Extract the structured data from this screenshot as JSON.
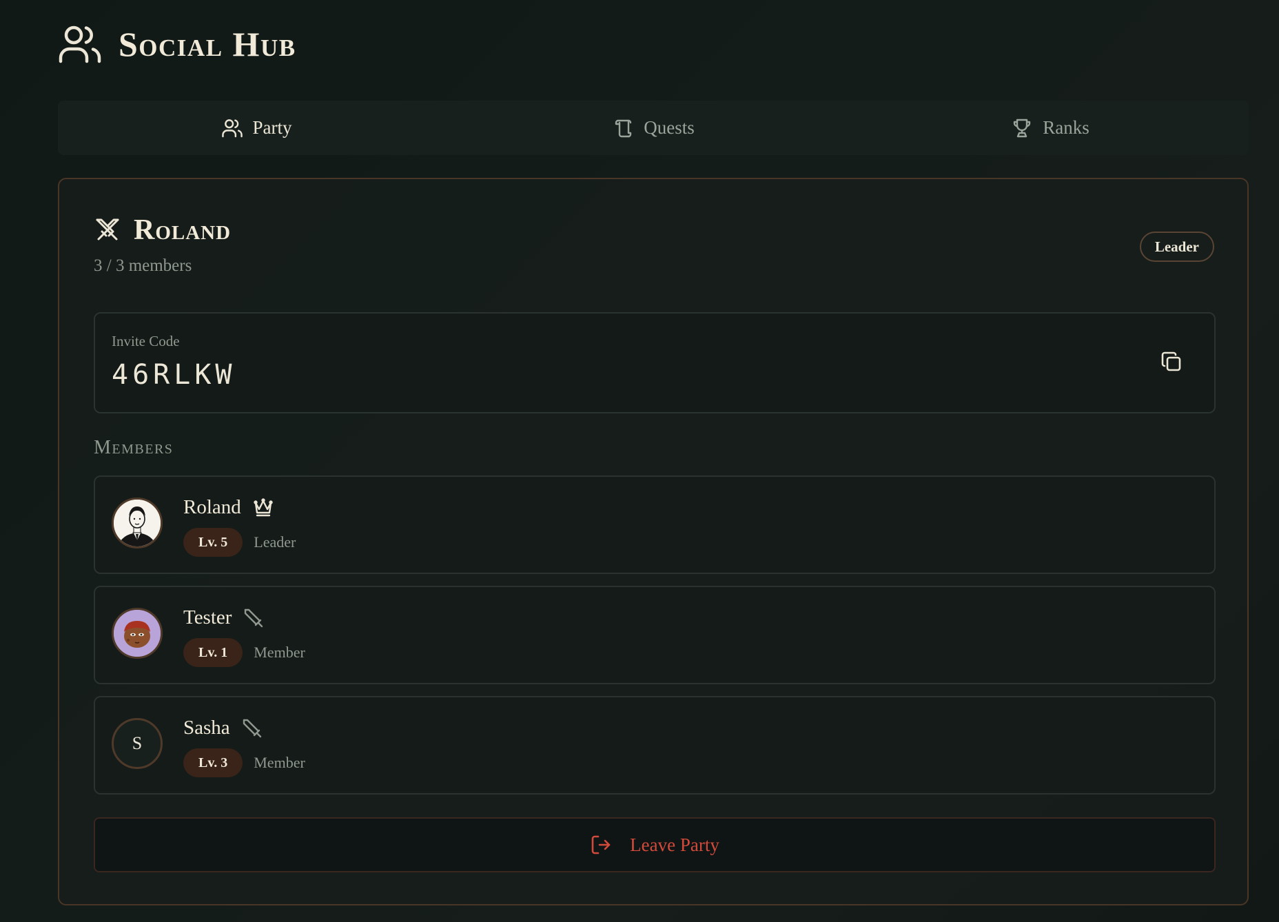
{
  "app": {
    "title": "Social Hub",
    "icon": "users-icon"
  },
  "tabs": [
    {
      "label": "Party",
      "icon": "users-icon",
      "active": true
    },
    {
      "label": "Quests",
      "icon": "scroll-icon",
      "active": false
    },
    {
      "label": "Ranks",
      "icon": "trophy-icon",
      "active": false
    }
  ],
  "party": {
    "name": "Roland",
    "icon": "crossed-swords-icon",
    "member_count": "3 / 3 members",
    "badge": "Leader",
    "invite": {
      "label": "Invite Code",
      "code": "46RLKW",
      "copy_icon": "copy-icon"
    },
    "members_title": "Members",
    "members": [
      {
        "name": "Roland",
        "level": "Lv. 5",
        "role": "Leader",
        "role_icon": "crown-icon",
        "avatar": "portrait-illustration"
      },
      {
        "name": "Tester",
        "level": "Lv. 1",
        "role": "Member",
        "role_icon": "sword-icon",
        "avatar": "cartoon-face-purple"
      },
      {
        "name": "Sasha",
        "level": "Lv. 3",
        "role": "Member",
        "role_icon": "sword-icon",
        "avatar_letter": "S"
      }
    ],
    "leave_label": "Leave Party",
    "leave_icon": "log-out-icon"
  },
  "colors": {
    "background": "#131a18",
    "accent_border": "#4a3626",
    "level_badge": "#3a2419",
    "danger": "#d24a3c",
    "text": "#ece6d6",
    "muted": "#8f998f"
  }
}
